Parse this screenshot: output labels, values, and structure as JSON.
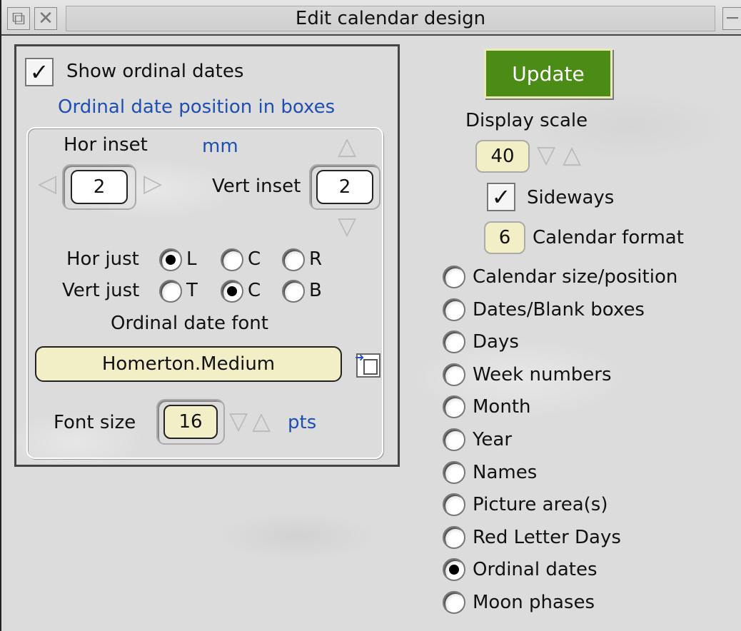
{
  "window": {
    "title": "Edit calendar design"
  },
  "left_panel": {
    "show_ordinal_dates": {
      "label": "Show ordinal dates",
      "checked": true,
      "mark": "✓"
    },
    "section_title": "Ordinal date position in boxes",
    "hor_inset": {
      "label": "Hor inset",
      "value": "2"
    },
    "unit_mm": "mm",
    "vert_inset": {
      "label": "Vert inset",
      "value": "2"
    },
    "hor_just": {
      "label": "Hor just",
      "options": [
        "L",
        "C",
        "R"
      ],
      "selected": "L"
    },
    "vert_just": {
      "label": "Vert just",
      "options": [
        "T",
        "C",
        "B"
      ],
      "selected": "C"
    },
    "font_label": "Ordinal date font",
    "font_value": "Homerton.Medium",
    "font_size": {
      "label": "Font size",
      "value": "16",
      "unit": "pts"
    }
  },
  "right_panel": {
    "update_label": "Update",
    "display_scale": {
      "label": "Display scale",
      "value": "40"
    },
    "sideways": {
      "label": "Sideways",
      "checked": true,
      "mark": "✓"
    },
    "calendar_format": {
      "label": "Calendar format",
      "value": "6"
    },
    "sections": [
      {
        "label": "Calendar size/position",
        "selected": false
      },
      {
        "label": "Dates/Blank boxes",
        "selected": false
      },
      {
        "label": "Days",
        "selected": false
      },
      {
        "label": "Week numbers",
        "selected": false
      },
      {
        "label": "Month",
        "selected": false
      },
      {
        "label": "Year",
        "selected": false
      },
      {
        "label": "Names",
        "selected": false
      },
      {
        "label": "Picture area(s)",
        "selected": false
      },
      {
        "label": "Red Letter Days",
        "selected": false
      },
      {
        "label": "Ordinal dates",
        "selected": true
      },
      {
        "label": "Moon phases",
        "selected": false
      }
    ]
  },
  "icons": {
    "arrow_left": "◁",
    "arrow_right": "▷",
    "arrow_up": "△",
    "arrow_down": "▽",
    "close": "✕",
    "back": "⧉",
    "toggle": "─"
  },
  "colors": {
    "update_bg": "#4b8c17",
    "field_yellow": "#f2efc6",
    "blue_text": "#1f4fb3"
  }
}
